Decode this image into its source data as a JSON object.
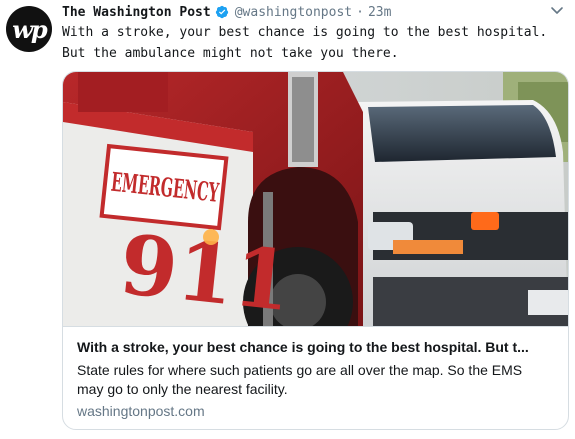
{
  "tweet": {
    "author_name": "The Washington Post",
    "author_handle": "@washingtonpost",
    "separator": "·",
    "timestamp": "23m",
    "avatar_text": "wp",
    "text": "With a stroke, your best chance is going to the best hospital.\nBut the ambulance might not take you there."
  },
  "card": {
    "image": {
      "emergency_text": "EMERGENCY",
      "number_text": "911"
    },
    "title": "With a stroke, your best chance is going to the best hospital. But t...",
    "description": "State rules for where such patients go are all over the map. So the EMS may go to only the nearest facility.",
    "domain": "washingtonpost.com"
  },
  "colors": {
    "verified_badge": "#1da1f2",
    "secondary_text": "#657786",
    "border": "#d6dde2"
  },
  "icons": {
    "verified": "verified-badge-icon",
    "menu": "chevron-down-icon"
  }
}
